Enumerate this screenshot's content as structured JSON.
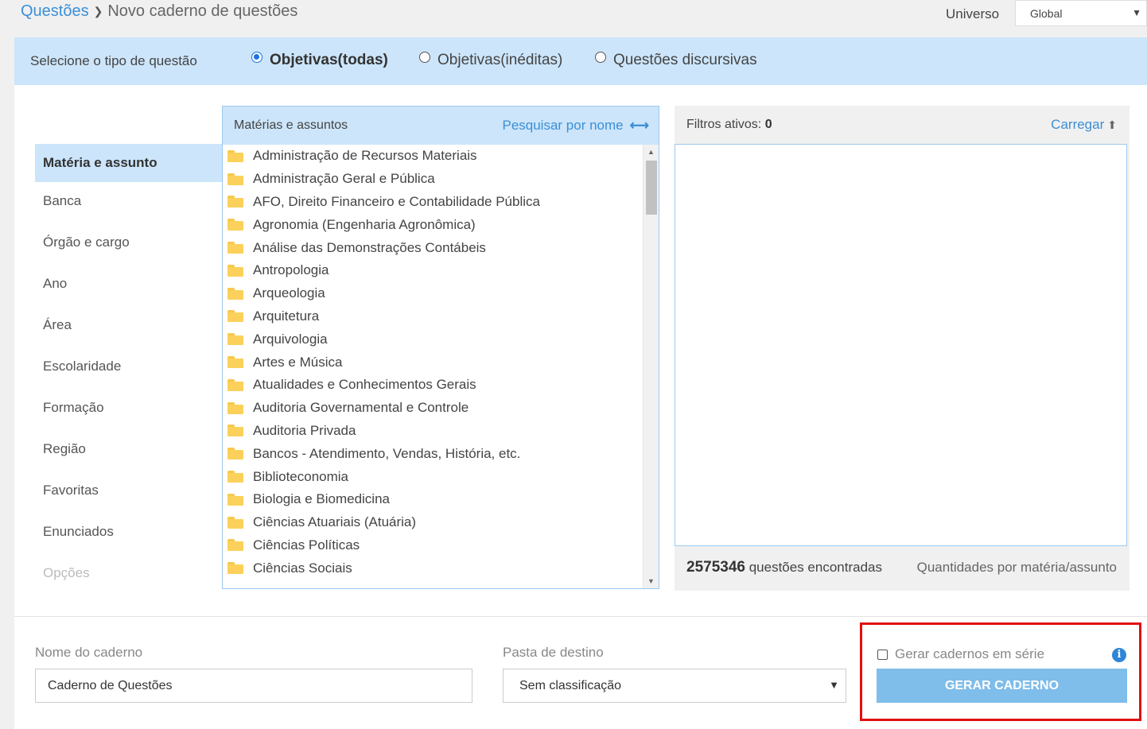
{
  "breadcrumb": {
    "root": "Questões",
    "separator": "❯",
    "current": "Novo caderno de questões"
  },
  "universo": {
    "label": "Universo",
    "value": "Global"
  },
  "question_type": {
    "label": "Selecione o tipo de questão",
    "options": [
      {
        "label": "Objetivas(todas)",
        "checked": true
      },
      {
        "label": "Objetivas(inéditas)",
        "checked": false
      },
      {
        "label": "Questões discursivas",
        "checked": false
      }
    ]
  },
  "filter_nav": [
    {
      "label": "Matéria e assunto",
      "active": true
    },
    {
      "label": "Banca"
    },
    {
      "label": "Órgão e cargo"
    },
    {
      "label": "Ano"
    },
    {
      "label": "Área"
    },
    {
      "label": "Escolaridade"
    },
    {
      "label": "Formação"
    },
    {
      "label": "Região"
    },
    {
      "label": "Favoritas"
    },
    {
      "label": "Enunciados"
    },
    {
      "label": "Opções",
      "disabled": true
    }
  ],
  "materias": {
    "header": "Matérias e assuntos",
    "search_link": "Pesquisar por nome",
    "search_icon": "⟷",
    "items": [
      "Administração de Recursos Materiais",
      "Administração Geral e Pública",
      "AFO, Direito Financeiro e Contabilidade Pública",
      "Agronomia (Engenharia Agronômica)",
      "Análise das Demonstrações Contábeis",
      "Antropologia",
      "Arqueologia",
      "Arquitetura",
      "Arquivologia",
      "Artes e Música",
      "Atualidades e Conhecimentos Gerais",
      "Auditoria Governamental e Controle",
      "Auditoria Privada",
      "Bancos - Atendimento, Vendas, História, etc.",
      "Biblioteconomia",
      "Biologia e Biomedicina",
      "Ciências Atuariais (Atuária)",
      "Ciências Políticas",
      "Ciências Sociais"
    ]
  },
  "active_filters": {
    "label": "Filtros ativos:",
    "count": "0",
    "load_link": "Carregar",
    "load_icon": "⬆"
  },
  "results": {
    "count": "2575346",
    "label": "questões encontradas",
    "quant_link": "Quantidades por matéria/assunto"
  },
  "notebook": {
    "name_label": "Nome do caderno",
    "name_value": "Caderno de Questões",
    "folder_label": "Pasta de destino",
    "folder_value": "Sem classificação",
    "serie_label": "Gerar cadernos em série",
    "info_icon": "i",
    "generate_button": "GERAR CADERNO"
  },
  "colors": {
    "accent": "#3b8fd6",
    "panel_bg": "#cce5fa",
    "button": "#7fbdea",
    "highlight": "#e01010"
  }
}
